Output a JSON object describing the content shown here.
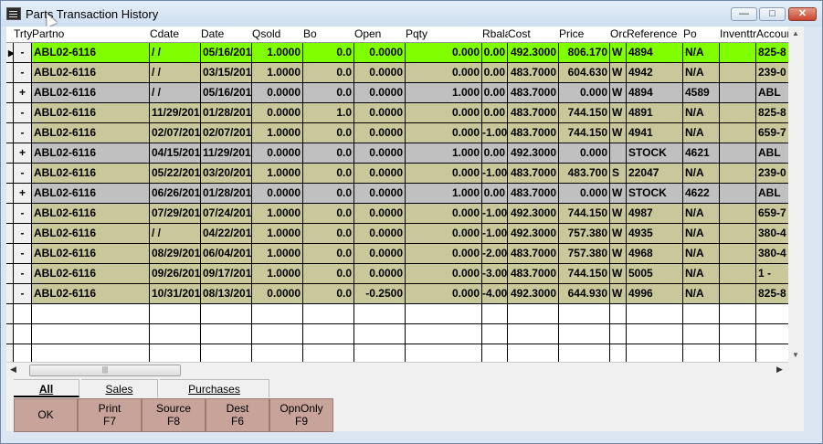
{
  "window": {
    "title": "Parts Transaction History"
  },
  "columns": [
    "Trty",
    "Partno",
    "Cdate",
    "Date",
    "Qsold",
    "Bo",
    "Open",
    "Pqty",
    "Rbalance",
    "Cost",
    "Price",
    "Ord",
    "Reference",
    "Po",
    "Inventtr",
    "Account"
  ],
  "rows": [
    {
      "trty": "-",
      "partno": "ABL02-6116",
      "cdate": " /  /",
      "date": "05/16/201",
      "qsold": "1.0000",
      "bo": "0.0",
      "open": "0.0000",
      "pqty": "0.000",
      "rbalance": "0.00",
      "cost": "492.3000",
      "price": "806.170",
      "ord": "W",
      "reference": "4894",
      "po": "N/A",
      "inv": "",
      "account": "825-8"
    },
    {
      "trty": "-",
      "partno": "ABL02-6116",
      "cdate": " /  /",
      "date": "03/15/201",
      "qsold": "1.0000",
      "bo": "0.0",
      "open": "0.0000",
      "pqty": "0.000",
      "rbalance": "0.00",
      "cost": "483.7000",
      "price": "604.630",
      "ord": "W",
      "reference": "4942",
      "po": "N/A",
      "inv": "",
      "account": "239-0"
    },
    {
      "trty": "+",
      "partno": "ABL02-6116",
      "cdate": " /  /",
      "date": "05/16/201",
      "qsold": "0.0000",
      "bo": "0.0",
      "open": "0.0000",
      "pqty": "1.000",
      "rbalance": "0.00",
      "cost": "483.7000",
      "price": "0.000",
      "ord": "W",
      "reference": "4894",
      "po": "4589",
      "inv": "",
      "account": "ABL"
    },
    {
      "trty": "-",
      "partno": "ABL02-6116",
      "cdate": "11/29/201",
      "date": "01/28/201",
      "qsold": "0.0000",
      "bo": "1.0",
      "open": "0.0000",
      "pqty": "0.000",
      "rbalance": "0.00",
      "cost": "483.7000",
      "price": "744.150",
      "ord": "W",
      "reference": "4891",
      "po": "N/A",
      "inv": "",
      "account": "825-8"
    },
    {
      "trty": "-",
      "partno": "ABL02-6116",
      "cdate": "02/07/201",
      "date": "02/07/201",
      "qsold": "1.0000",
      "bo": "0.0",
      "open": "0.0000",
      "pqty": "0.000",
      "rbalance": "-1.00",
      "cost": "483.7000",
      "price": "744.150",
      "ord": "W",
      "reference": "4941",
      "po": "N/A",
      "inv": "",
      "account": "659-7"
    },
    {
      "trty": "+",
      "partno": "ABL02-6116",
      "cdate": "04/15/201",
      "date": "11/29/201",
      "qsold": "0.0000",
      "bo": "0.0",
      "open": "0.0000",
      "pqty": "1.000",
      "rbalance": "0.00",
      "cost": "492.3000",
      "price": "0.000",
      "ord": "",
      "reference": "STOCK",
      "po": "4621",
      "inv": "",
      "account": "ABL"
    },
    {
      "trty": "-",
      "partno": "ABL02-6116",
      "cdate": "05/22/201",
      "date": "03/20/201",
      "qsold": "1.0000",
      "bo": "0.0",
      "open": "0.0000",
      "pqty": "0.000",
      "rbalance": "-1.00",
      "cost": "483.7000",
      "price": "483.700",
      "ord": "S",
      "reference": "22047",
      "po": "N/A",
      "inv": "",
      "account": "239-0"
    },
    {
      "trty": "+",
      "partno": "ABL02-6116",
      "cdate": "06/26/201",
      "date": "01/28/201",
      "qsold": "0.0000",
      "bo": "0.0",
      "open": "0.0000",
      "pqty": "1.000",
      "rbalance": "0.00",
      "cost": "483.7000",
      "price": "0.000",
      "ord": "W",
      "reference": "STOCK",
      "po": "4622",
      "inv": "",
      "account": "ABL"
    },
    {
      "trty": "-",
      "partno": "ABL02-6116",
      "cdate": "07/29/201",
      "date": "07/24/201",
      "qsold": "1.0000",
      "bo": "0.0",
      "open": "0.0000",
      "pqty": "0.000",
      "rbalance": "-1.00",
      "cost": "492.3000",
      "price": "744.150",
      "ord": "W",
      "reference": "4987",
      "po": "N/A",
      "inv": "",
      "account": "659-7"
    },
    {
      "trty": "-",
      "partno": "ABL02-6116",
      "cdate": " /  /",
      "date": "04/22/201",
      "qsold": "1.0000",
      "bo": "0.0",
      "open": "0.0000",
      "pqty": "0.000",
      "rbalance": "-1.00",
      "cost": "492.3000",
      "price": "757.380",
      "ord": "W",
      "reference": "4935",
      "po": "N/A",
      "inv": "",
      "account": "380-4"
    },
    {
      "trty": "-",
      "partno": "ABL02-6116",
      "cdate": "08/29/201",
      "date": "06/04/201",
      "qsold": "1.0000",
      "bo": "0.0",
      "open": "0.0000",
      "pqty": "0.000",
      "rbalance": "-2.00",
      "cost": "483.7000",
      "price": "757.380",
      "ord": "W",
      "reference": "4968",
      "po": "N/A",
      "inv": "",
      "account": "380-4"
    },
    {
      "trty": "-",
      "partno": "ABL02-6116",
      "cdate": "09/26/201",
      "date": "09/17/201",
      "qsold": "1.0000",
      "bo": "0.0",
      "open": "0.0000",
      "pqty": "0.000",
      "rbalance": "-3.00",
      "cost": "483.7000",
      "price": "744.150",
      "ord": "W",
      "reference": "5005",
      "po": "N/A",
      "inv": "",
      "account": "1  -"
    },
    {
      "trty": "-",
      "partno": "ABL02-6116",
      "cdate": "10/31/201",
      "date": "08/13/201",
      "qsold": "0.0000",
      "bo": "0.0",
      "open": "-0.2500",
      "pqty": "0.000",
      "rbalance": "-4.00",
      "cost": "492.3000",
      "price": "644.930",
      "ord": "W",
      "reference": "4996",
      "po": "N/A",
      "inv": "",
      "account": "825-8"
    }
  ],
  "colors": {
    "selected": "#80ff00",
    "tan": "#c8c89a",
    "grey": "#c0c0c0"
  },
  "row_styles": [
    "selected",
    "tan",
    "grey",
    "tan",
    "tan",
    "grey",
    "tan",
    "grey",
    "tan",
    "tan",
    "tan",
    "tan",
    "tan"
  ],
  "tabs": [
    {
      "label": "All",
      "active": true
    },
    {
      "label": "Sales",
      "active": false
    },
    {
      "label": "Purchases",
      "active": false
    }
  ],
  "buttons": [
    {
      "name": "ok-button",
      "line1": "OK",
      "line2": ""
    },
    {
      "name": "print-button",
      "line1": "Print",
      "line2": "F7"
    },
    {
      "name": "source-button",
      "line1": "Source",
      "line2": "F8"
    },
    {
      "name": "dest-button",
      "line1": "Dest",
      "line2": "F6"
    },
    {
      "name": "opnonly-button",
      "line1": "OpnOnly",
      "line2": "F9"
    }
  ],
  "icons": {
    "app": "app-window-icon",
    "minimize": "minimize-icon",
    "maximize": "maximize-icon",
    "close": "close-icon",
    "row_pointer": "row-pointer-icon"
  }
}
